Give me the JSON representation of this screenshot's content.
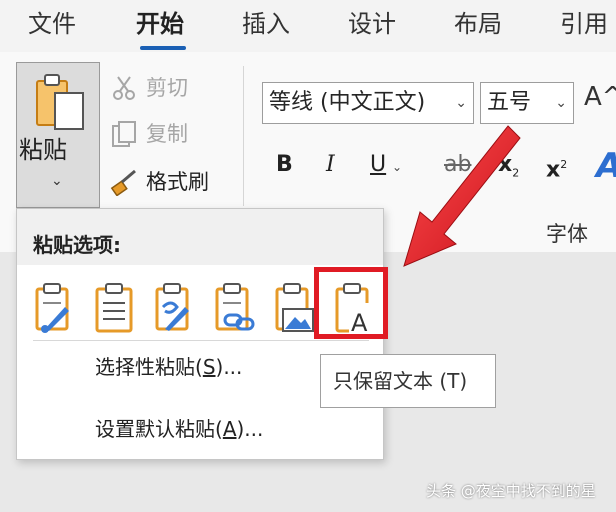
{
  "tabs": [
    {
      "label": "文件"
    },
    {
      "label": "开始"
    },
    {
      "label": "插入"
    },
    {
      "label": "设计"
    },
    {
      "label": "布局"
    },
    {
      "label": "引用"
    }
  ],
  "clipboard": {
    "paste_label": "粘贴",
    "cut_label": "剪切",
    "copy_label": "复制",
    "format_painter_label": "格式刷"
  },
  "font": {
    "font_name": "等线 (中文正文)",
    "font_size": "五号",
    "grow_icon": "A^",
    "bold": "B",
    "italic": "I",
    "underline": "U",
    "strikethrough": "ab",
    "subscript": "x",
    "subscript_mark": "2",
    "superscript": "x",
    "superscript_mark": "2",
    "group_label": "字体"
  },
  "paste_menu": {
    "title": "粘贴选项:",
    "options": [
      {
        "icon": "keep-source-formatting-icon"
      },
      {
        "icon": "merge-formatting-icon"
      },
      {
        "icon": "use-destination-styles-icon"
      },
      {
        "icon": "link-icon"
      },
      {
        "icon": "picture-icon"
      },
      {
        "icon": "keep-text-only-icon"
      }
    ],
    "paste_special": {
      "text": "选择性粘贴(",
      "key": "S",
      "suffix": ")..."
    },
    "set_default": {
      "text": "设置默认粘贴(",
      "key": "A",
      "suffix": ")..."
    }
  },
  "tooltip": "只保留文本 (T)",
  "watermark": "头条 @夜空中找不到的星",
  "colors": {
    "accent": "#1a5fb4",
    "highlight": "#e01b24",
    "clipboard_orange": "#e69a28"
  }
}
